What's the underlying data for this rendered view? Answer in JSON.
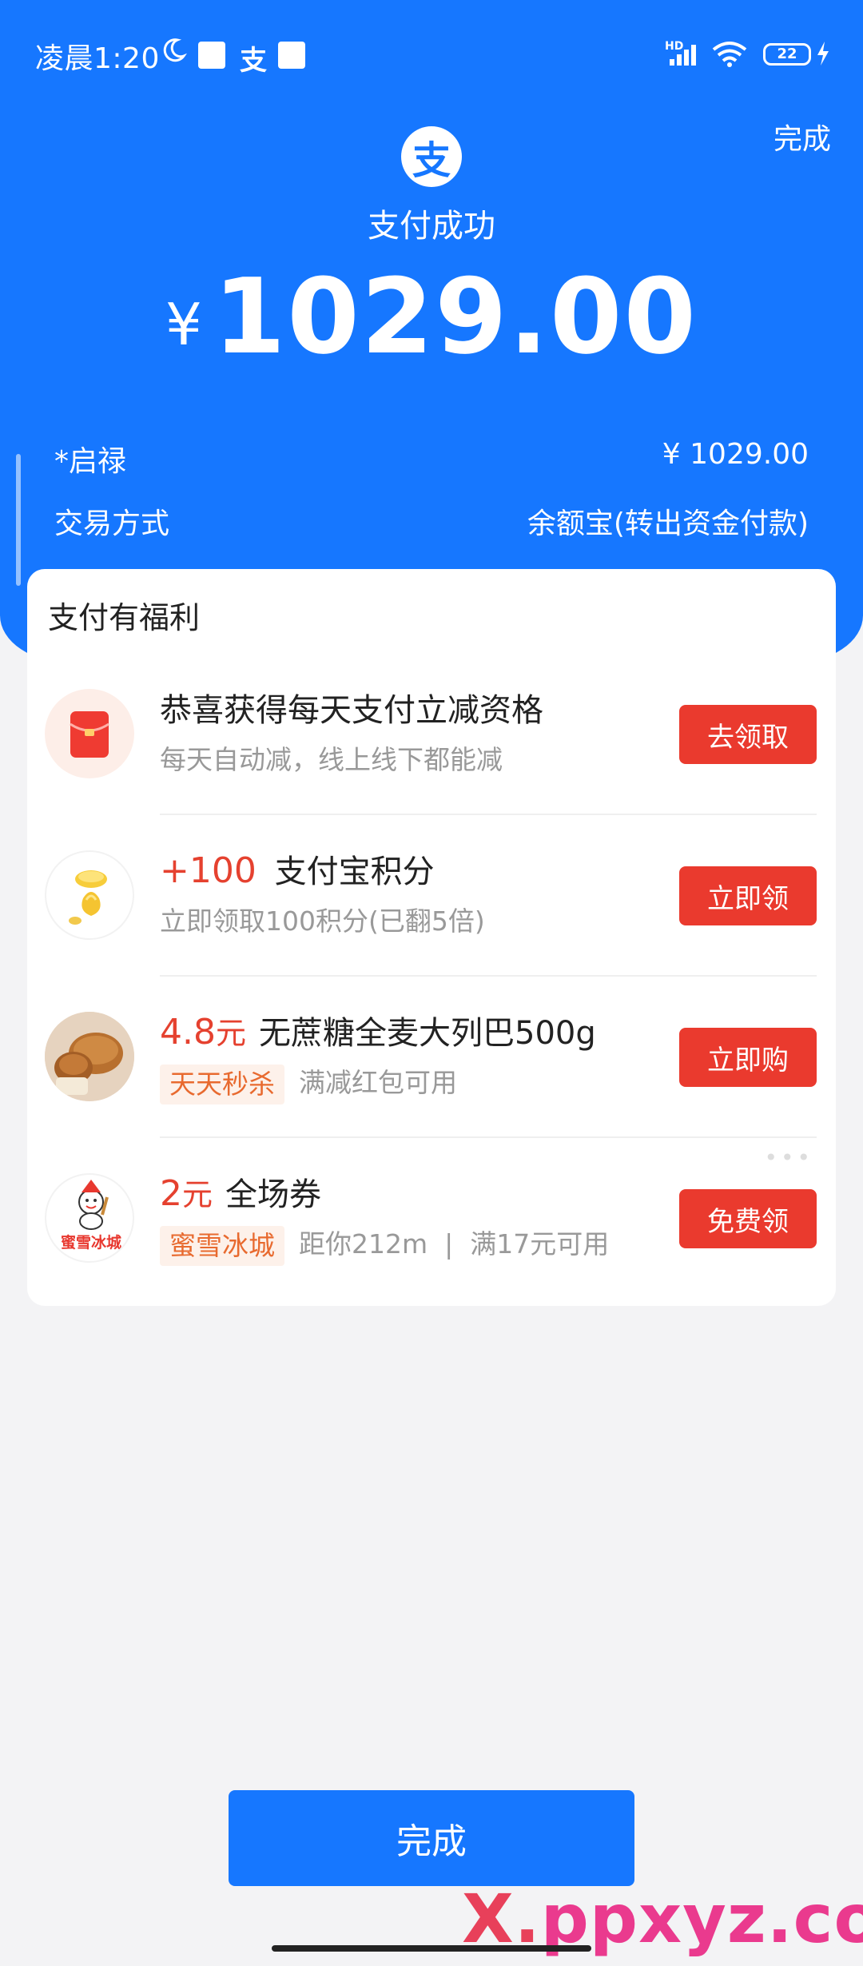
{
  "status_bar": {
    "time": "凌晨1:20",
    "alipay_glyph": "支",
    "network_label": "HD",
    "battery": "22"
  },
  "header": {
    "done_label": "完成",
    "logo_glyph": "支",
    "status_text": "支付成功",
    "currency": "¥",
    "amount": "1029.00"
  },
  "details": {
    "payee": "*启禄",
    "payee_amount": "¥ 1029.00",
    "method_label": "交易方式",
    "method_value": "余额宝(转出资金付款)"
  },
  "benefits": {
    "title": "支付有福利",
    "items": [
      {
        "title": "恭喜获得每天支付立减资格",
        "subtitle": "每天自动减，线上线下都能减",
        "action": "去领取",
        "icon": "red-envelope-icon"
      },
      {
        "highlight": "+100",
        "title": "支付宝积分",
        "subtitle": "立即领取100积分(已翻5倍)",
        "action": "立即领",
        "icon": "gold-coin-icon"
      },
      {
        "highlight": "4.8",
        "highlight_unit": "元",
        "title": "无蔗糖全麦大列巴500g",
        "tag": "天天秒杀",
        "subtitle": "满减红包可用",
        "action": "立即购",
        "icon": "bread-icon"
      },
      {
        "highlight": "2",
        "highlight_unit": "元",
        "title": "全场券",
        "tag": "蜜雪冰城",
        "subtitle": "距你212m  |  满17元可用",
        "action": "免费领",
        "icon": "mixue-logo-icon",
        "logo_text": "蜜雪冰城"
      }
    ]
  },
  "footer": {
    "done_label": "完成"
  },
  "watermark": {
    "prefix": "X.",
    "text": "ppxyz.com"
  },
  "colors": {
    "primary_blue": "#1677ff",
    "action_red": "#ea3a2e",
    "highlight_red": "#e5412f",
    "tag_orange": "#e86a2f"
  }
}
